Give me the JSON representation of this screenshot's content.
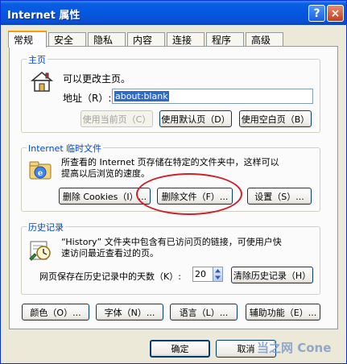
{
  "window": {
    "title": "Internet 属性"
  },
  "titlebar": {
    "help": "?",
    "close": "×"
  },
  "tabs": [
    "常规",
    "安全",
    "隐私",
    "内容",
    "连接",
    "程序",
    "高级"
  ],
  "home": {
    "group_label": "主页",
    "desc": "可以更改主页。",
    "address_label": "地址（R）:",
    "address_value": "about:blank",
    "btn_current": "使用当前页（C）",
    "btn_default": "使用默认页（D）",
    "btn_blank": "使用空白页（B）"
  },
  "temp": {
    "group_label": "Internet 临时文件",
    "desc1": "所查看的 Internet 页存储在特定的文件夹中，这样可以",
    "desc2": "提高以后浏览的速度。",
    "btn_cookies": "删除 Cookies（I）...",
    "btn_files": "删除文件（F）...",
    "btn_settings": "设置（S）..."
  },
  "history": {
    "group_label": "历史记录",
    "desc1": "“History” 文件夹中包含有已访问页的链接，可使用户快",
    "desc2": "速访问最近查看过的页。",
    "days_label": "网页保存在历史记录中的天数（K）:",
    "days_value": "20",
    "btn_clear": "清除历史记录（H）"
  },
  "bottom_buttons": {
    "colors": "颜色（O）...",
    "fonts": "字体（N）...",
    "languages": "语言（L）...",
    "accessibility": "辅助功能（E）..."
  },
  "dialog": {
    "ok": "确定",
    "cancel": "取消"
  },
  "watermark": "当之网 Cone"
}
